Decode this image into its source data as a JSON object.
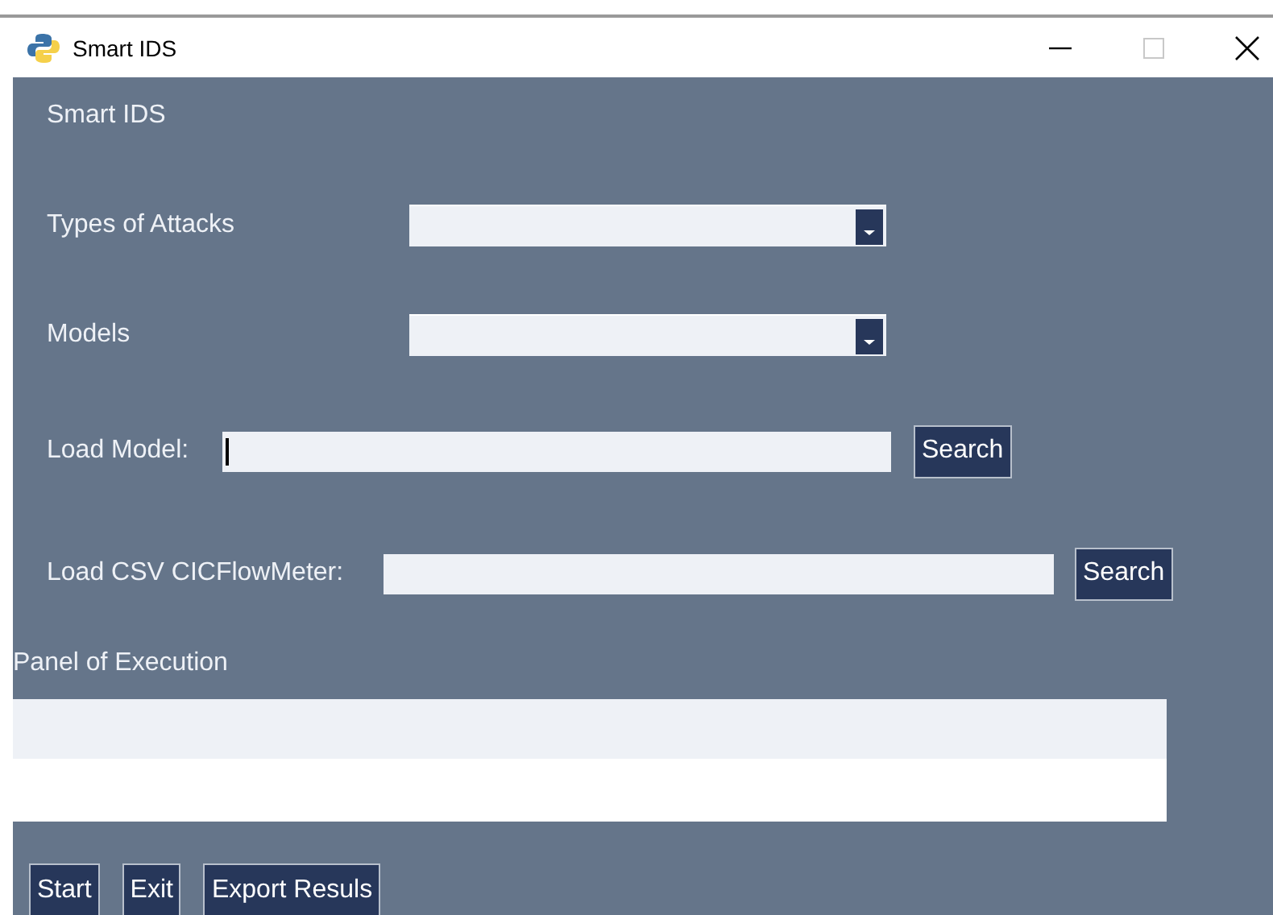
{
  "window": {
    "title": "Smart IDS"
  },
  "heading": "Smart IDS",
  "fields": [
    {
      "kind": "combobox",
      "label": "Types of Attacks"
    },
    {
      "kind": "combobox",
      "label": "Models"
    },
    {
      "kind": "entry",
      "label": "Load Model:",
      "focused": true,
      "button": "Search"
    },
    {
      "kind": "entry",
      "label": "Load CSV CICFlowMeter:",
      "focused": false,
      "button": "Search"
    }
  ],
  "panel": {
    "label": "Panel of Execution"
  },
  "buttons": [
    "Start",
    "Exit",
    "Export Resuls"
  ]
}
